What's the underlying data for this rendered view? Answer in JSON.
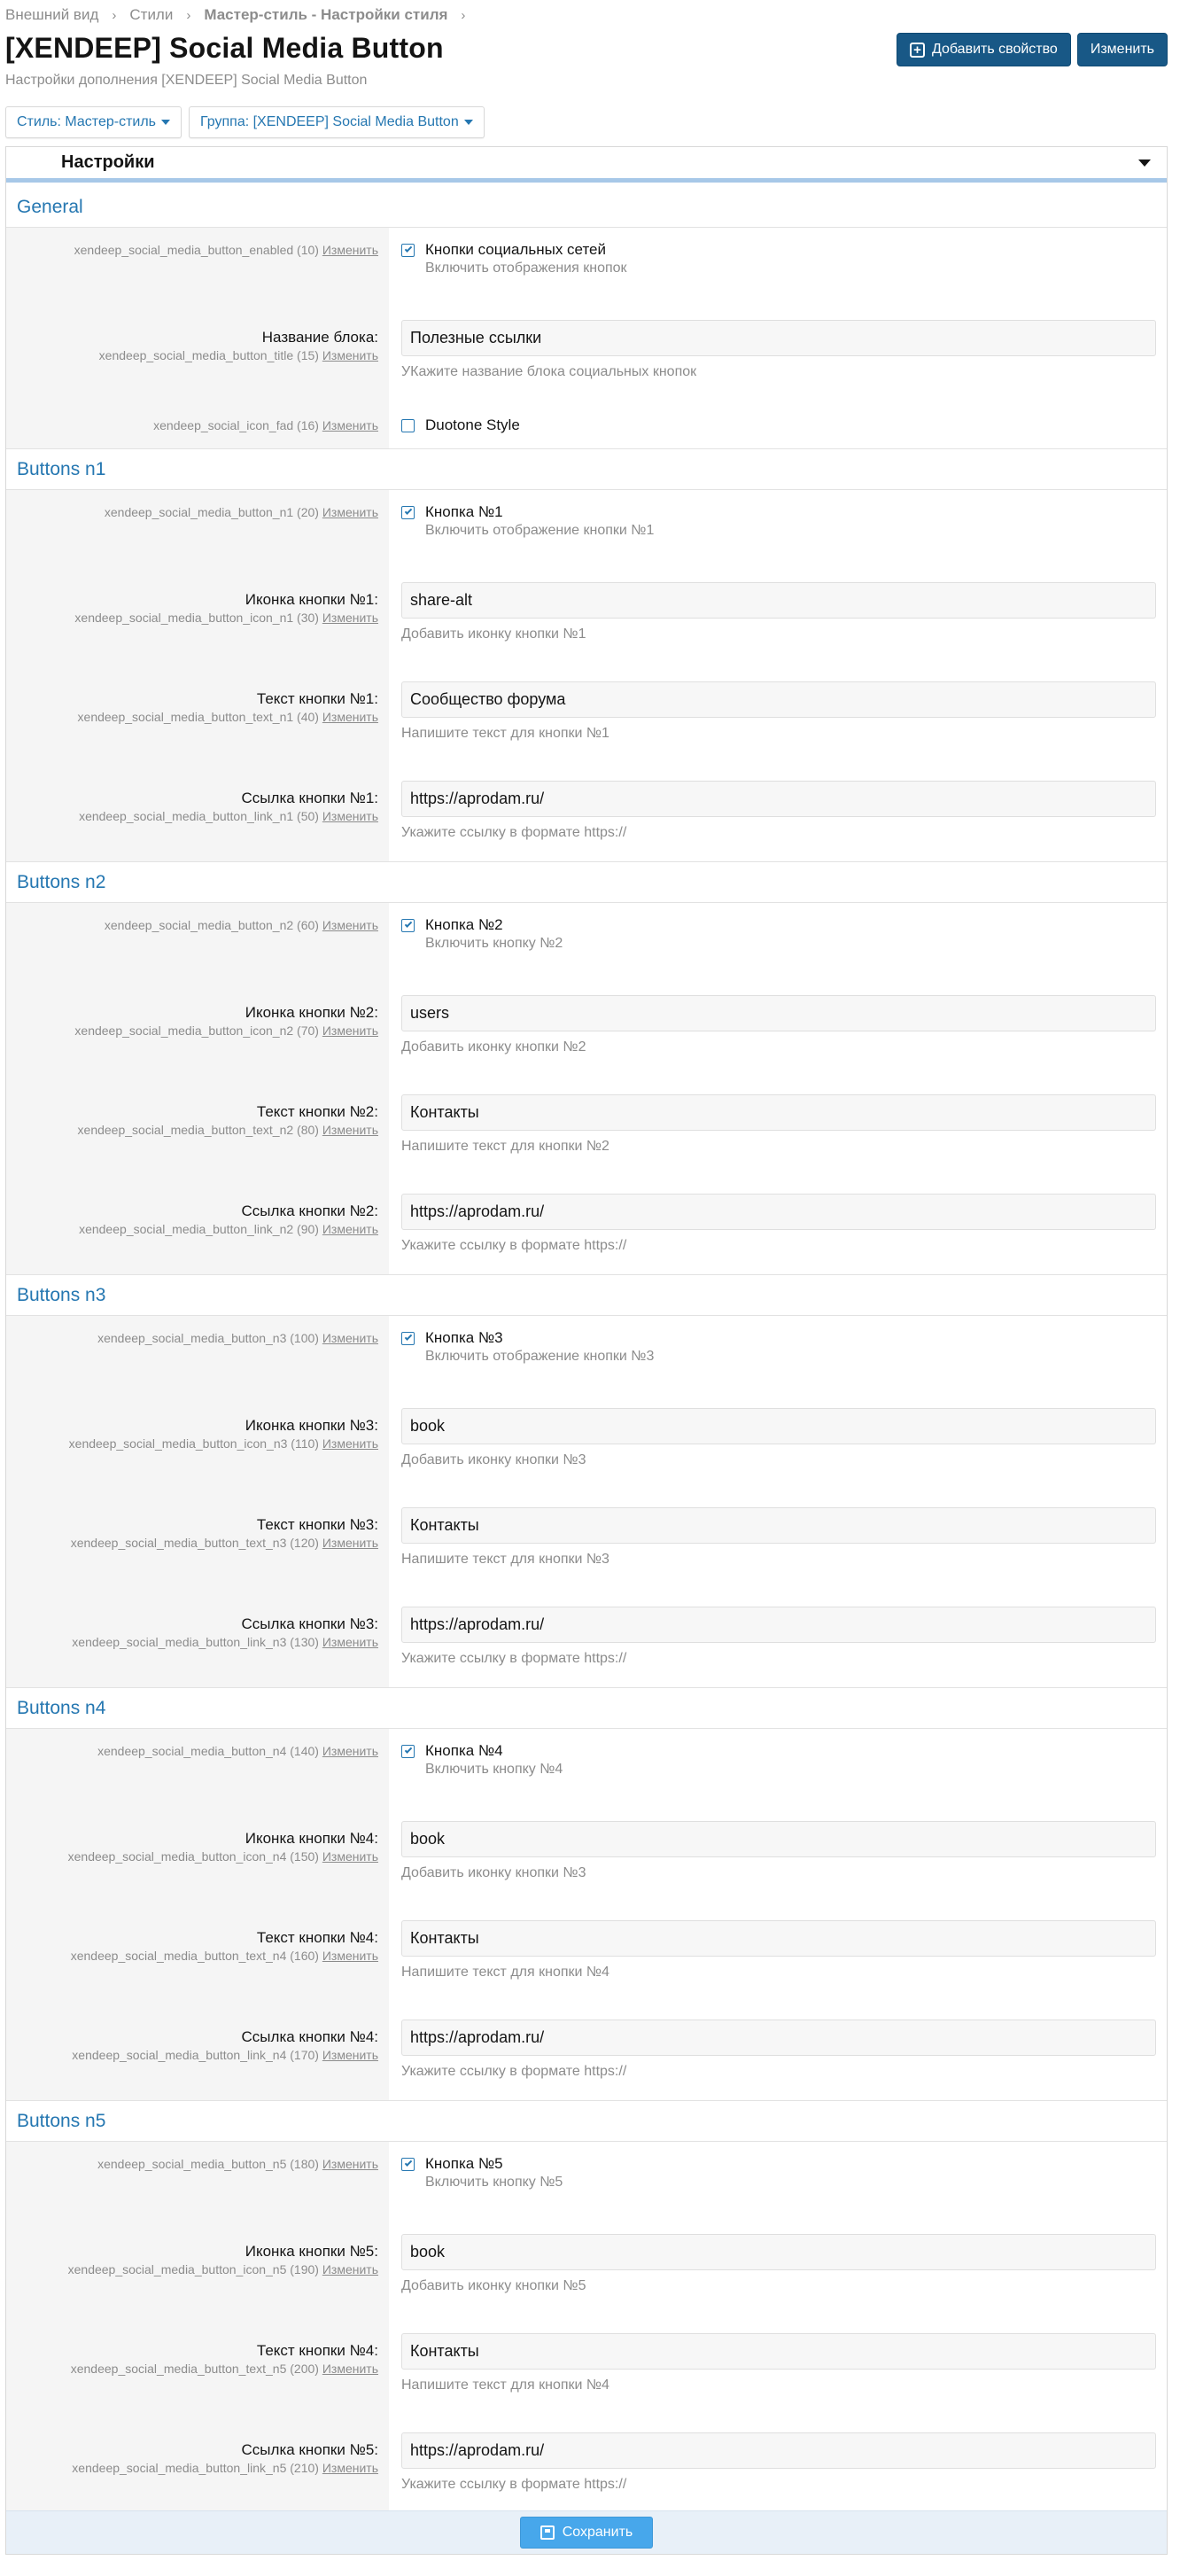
{
  "breadcrumb": [
    "Внешний вид",
    "Стили",
    "Мастер-стиль - Настройки стиля"
  ],
  "title": "[XENDEEP] Social Media Button",
  "description": "Настройки дополнения [XENDEEP] Social Media Button",
  "buttons": {
    "add_property": "Добавить свойство",
    "edit": "Изменить"
  },
  "filters": {
    "style": "Стиль: Мастер-стиль",
    "group": "Группа: [XENDEEP] Social Media Button"
  },
  "block_title": "Настройки",
  "edit_link": "Изменить",
  "save_label": "Сохранить",
  "colors": {
    "accent": "#2577b1",
    "primary_button": "#185886",
    "save_button": "#47a7eb"
  },
  "groups": [
    {
      "title": "General",
      "options": [
        {
          "type": "checkbox",
          "id": "xendeep_social_media_button_enabled (10)",
          "checked": true,
          "label": "Кнопки социальных сетей",
          "hint": "Включить отображения кнопок"
        },
        {
          "type": "text",
          "label": "Название блока:",
          "id": "xendeep_social_media_button_title (15)",
          "value": "Полезные ссылки",
          "hint": "УКажите название блока социальных кнопок"
        },
        {
          "type": "checkbox",
          "id": "xendeep_social_icon_fad (16)",
          "checked": false,
          "label": "Duotone Style",
          "hint": ""
        }
      ]
    },
    {
      "title": "Buttons n1",
      "options": [
        {
          "type": "checkbox",
          "id": "xendeep_social_media_button_n1 (20)",
          "checked": true,
          "label": "Кнопка №1",
          "hint": "Включить отображение кнопки №1"
        },
        {
          "type": "text",
          "label": "Иконка кнопки №1:",
          "id": "xendeep_social_media_button_icon_n1 (30)",
          "value": "share-alt",
          "hint": "Добавить иконку кнопки №1"
        },
        {
          "type": "text",
          "label": "Текст кнопки №1:",
          "id": "xendeep_social_media_button_text_n1 (40)",
          "value": "Сообщество форума",
          "hint": "Напишите текст для кнопки №1"
        },
        {
          "type": "text",
          "label": "Ссылка кнопки №1:",
          "id": "xendeep_social_media_button_link_n1 (50)",
          "value": "https://aprodam.ru/",
          "hint": "Укажите ссылку в формате https://"
        }
      ]
    },
    {
      "title": "Buttons n2",
      "options": [
        {
          "type": "checkbox",
          "id": "xendeep_social_media_button_n2 (60)",
          "checked": true,
          "label": "Кнопка №2",
          "hint": "Включить кнопку №2"
        },
        {
          "type": "text",
          "label": "Иконка кнопки №2:",
          "id": "xendeep_social_media_button_icon_n2 (70)",
          "value": "users",
          "hint": "Добавить иконку кнопки №2"
        },
        {
          "type": "text",
          "label": "Текст кнопки №2:",
          "id": "xendeep_social_media_button_text_n2 (80)",
          "value": "Контакты",
          "hint": "Напишите текст для кнопки №2"
        },
        {
          "type": "text",
          "label": "Ссылка кнопки №2:",
          "id": "xendeep_social_media_button_link_n2 (90)",
          "value": "https://aprodam.ru/",
          "hint": "Укажите ссылку в формате https://"
        }
      ]
    },
    {
      "title": "Buttons n3",
      "options": [
        {
          "type": "checkbox",
          "id": "xendeep_social_media_button_n3 (100)",
          "checked": true,
          "label": "Кнопка №3",
          "hint": "Включить отображение кнопки №3"
        },
        {
          "type": "text",
          "label": "Иконка кнопки №3:",
          "id": "xendeep_social_media_button_icon_n3 (110)",
          "value": "book",
          "hint": "Добавить иконку кнопки №3"
        },
        {
          "type": "text",
          "label": "Текст кнопки №3:",
          "id": "xendeep_social_media_button_text_n3 (120)",
          "value": "Контакты",
          "hint": "Напишите текст для кнопки №3"
        },
        {
          "type": "text",
          "label": "Ссылка кнопки №3:",
          "id": "xendeep_social_media_button_link_n3 (130)",
          "value": "https://aprodam.ru/",
          "hint": "Укажите ссылку в формате https://"
        }
      ]
    },
    {
      "title": "Buttons n4",
      "options": [
        {
          "type": "checkbox",
          "id": "xendeep_social_media_button_n4 (140)",
          "checked": true,
          "label": "Кнопка №4",
          "hint": "Включить кнопку №4"
        },
        {
          "type": "text",
          "label": "Иконка кнопки №4:",
          "id": "xendeep_social_media_button_icon_n4 (150)",
          "value": "book",
          "hint": "Добавить иконку кнопки №3"
        },
        {
          "type": "text",
          "label": "Текст кнопки №4:",
          "id": "xendeep_social_media_button_text_n4 (160)",
          "value": "Контакты",
          "hint": "Напишите текст для кнопки №4"
        },
        {
          "type": "text",
          "label": "Ссылка кнопки №4:",
          "id": "xendeep_social_media_button_link_n4 (170)",
          "value": "https://aprodam.ru/",
          "hint": "Укажите ссылку в формате https://"
        }
      ]
    },
    {
      "title": "Buttons n5",
      "options": [
        {
          "type": "checkbox",
          "id": "xendeep_social_media_button_n5 (180)",
          "checked": true,
          "label": "Кнопка №5",
          "hint": "Включить кнопку №5"
        },
        {
          "type": "text",
          "label": "Иконка кнопки №5:",
          "id": "xendeep_social_media_button_icon_n5 (190)",
          "value": "book",
          "hint": "Добавить иконку кнопки №5"
        },
        {
          "type": "text",
          "label": "Текст кнопки №4:",
          "id": "xendeep_social_media_button_text_n5 (200)",
          "value": "Контакты",
          "hint": "Напишите текст для кнопки №4"
        },
        {
          "type": "text",
          "label": "Ссылка кнопки №5:",
          "id": "xendeep_social_media_button_link_n5 (210)",
          "value": "https://aprodam.ru/",
          "hint": "Укажите ссылку в формате https://"
        }
      ]
    }
  ]
}
